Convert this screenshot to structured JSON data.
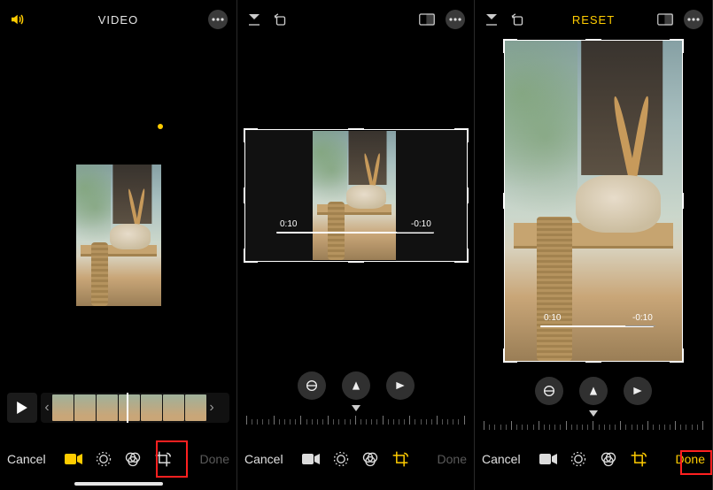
{
  "panel1": {
    "title": "VIDEO",
    "cancel": "Cancel",
    "done": "Done"
  },
  "panel2": {
    "cancel": "Cancel",
    "done": "Done",
    "time_start": "0:10",
    "time_end": "-0:10"
  },
  "panel3": {
    "reset": "RESET",
    "cancel": "Cancel",
    "done": "Done",
    "time_start": "0:10",
    "time_end": "-0:10"
  }
}
